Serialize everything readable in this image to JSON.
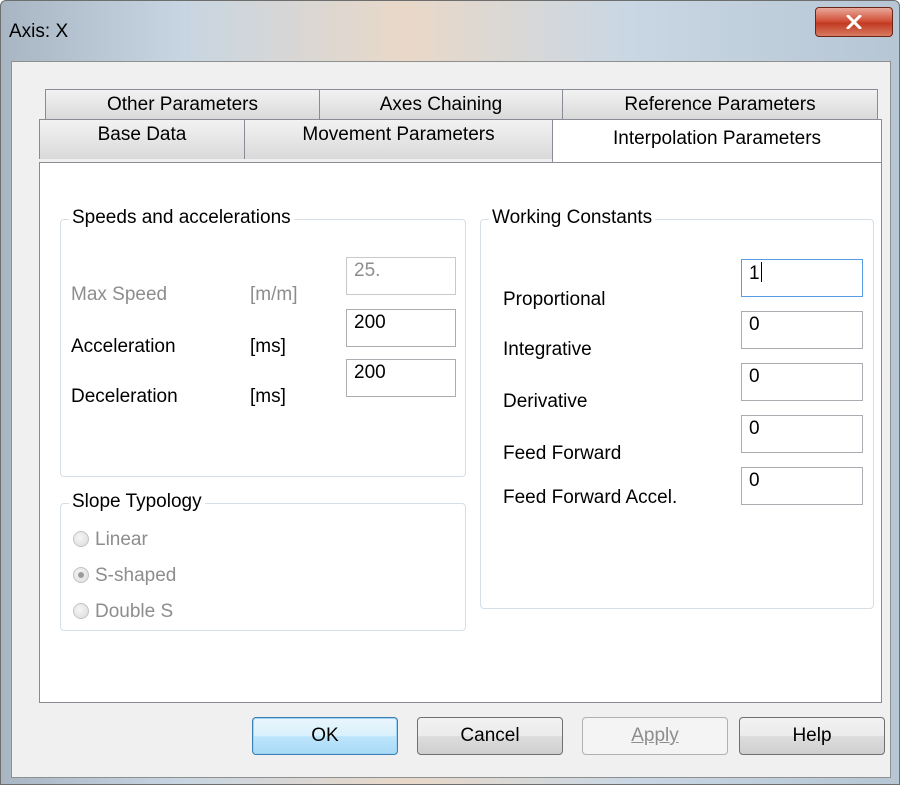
{
  "window": {
    "title": "Axis: X"
  },
  "tabs": {
    "row1": [
      "Other Parameters",
      "Axes Chaining",
      "Reference Parameters"
    ],
    "row2": [
      "Base Data",
      "Movement Parameters",
      "Interpolation Parameters"
    ],
    "active": "Interpolation Parameters"
  },
  "speeds": {
    "caption": "Speeds and accelerations",
    "rows": [
      {
        "label": "Max Speed",
        "unit": "[m/m]",
        "value": "25.",
        "enabled": false
      },
      {
        "label": "Acceleration",
        "unit": "[ms]",
        "value": "200",
        "enabled": true
      },
      {
        "label": "Deceleration",
        "unit": "[ms]",
        "value": "200",
        "enabled": true
      }
    ]
  },
  "slope": {
    "caption": "Slope Typology",
    "options": [
      "Linear",
      "S-shaped",
      "Double S"
    ],
    "selected": "S-shaped",
    "enabled": false
  },
  "constants": {
    "caption": "Working Constants",
    "rows": [
      {
        "label": "Proportional",
        "value": "1"
      },
      {
        "label": "Integrative",
        "value": "0"
      },
      {
        "label": "Derivative",
        "value": "0"
      },
      {
        "label": "Feed Forward",
        "value": "0"
      },
      {
        "label": "Feed Forward Accel.",
        "value": "0"
      }
    ]
  },
  "buttons": {
    "ok": "OK",
    "cancel": "Cancel",
    "apply": "Apply",
    "help": "Help"
  }
}
